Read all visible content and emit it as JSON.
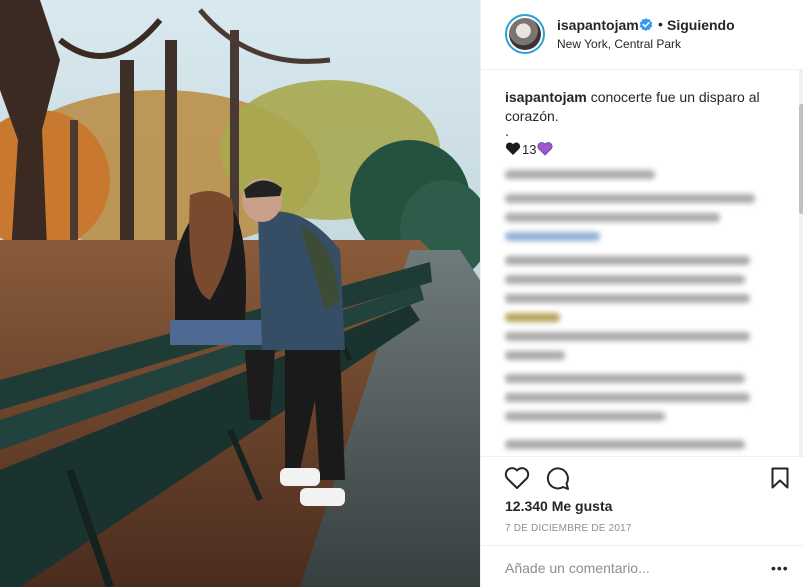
{
  "post": {
    "username": "isapantojam",
    "follow_status": "Siguiendo",
    "separator": "•",
    "location": "New York, Central Park",
    "caption_user": "isapantojam",
    "caption_text": "conocerte fue un disparo al corazón.",
    "caption_dot": ".",
    "heart_count": "13",
    "likes_text": "12.340 Me gusta",
    "date_text": "7 DE DICIEMBRE DE 2017",
    "comment_placeholder": "Añade un comentario...",
    "more_label": "•••"
  },
  "icons": {
    "verified": "verified-badge-icon",
    "black_heart": "black-heart-icon",
    "purple_heart": "purple-heart-icon",
    "like": "heart-icon",
    "comment": "comment-icon",
    "save": "bookmark-icon",
    "more": "more-options-icon"
  },
  "colors": {
    "verified": "#3897f0",
    "link": "#003569",
    "muted": "#8e8e8e",
    "text": "#262626"
  }
}
